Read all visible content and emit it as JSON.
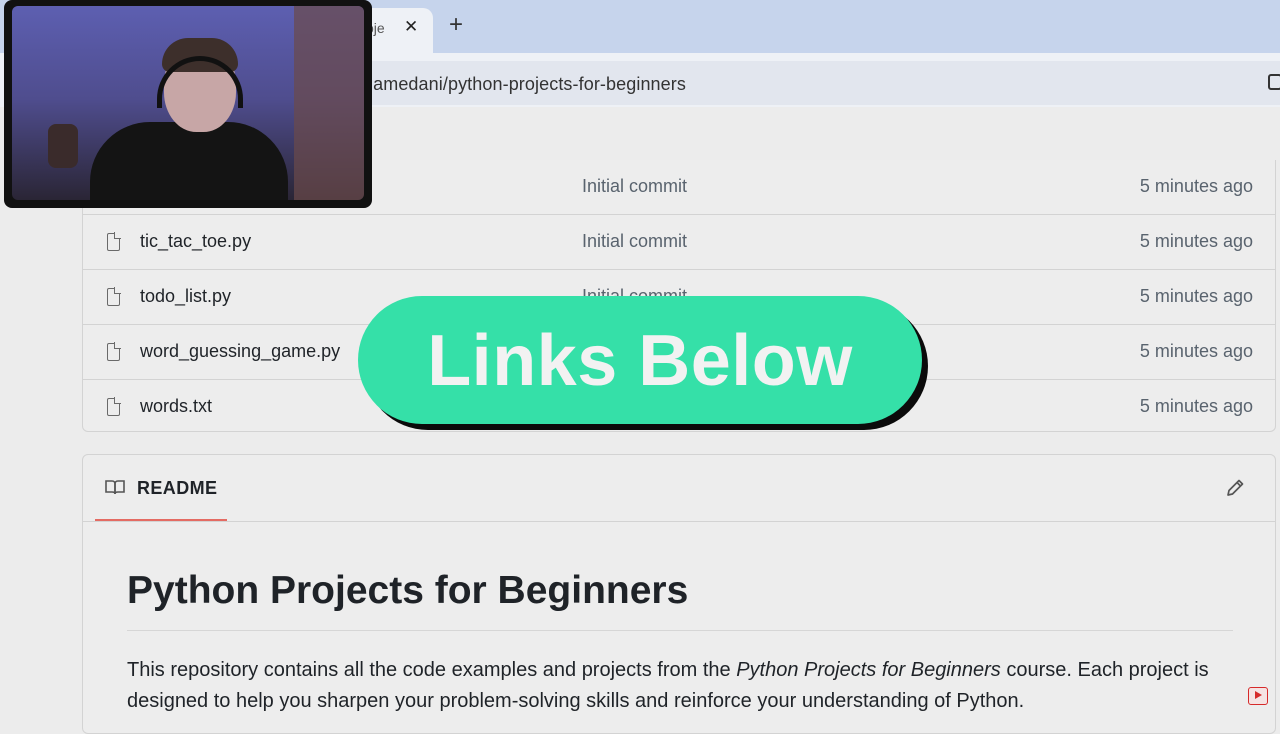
{
  "browser": {
    "tab_title_fragment": "oje",
    "tab_close": "✕",
    "new_tab": "+",
    "url": "hamedani/python-projects-for-beginners"
  },
  "file_list": {
    "rows": [
      {
        "name": "",
        "commit": "Initial commit",
        "time": "5 minutes ago"
      },
      {
        "name": "tic_tac_toe.py",
        "commit": "Initial commit",
        "time": "5 minutes ago"
      },
      {
        "name": "todo_list.py",
        "commit": "Initial commit",
        "time": "5 minutes ago"
      },
      {
        "name": "word_guessing_game.py",
        "commit": "",
        "time": "5 minutes ago"
      },
      {
        "name": "words.txt",
        "commit": "",
        "time": "5 minutes ago"
      }
    ]
  },
  "readme": {
    "tab_label": "README",
    "title": "Python Projects for Beginners",
    "para_part1": "This repository contains all the code examples and projects from the ",
    "para_italic": "Python Projects for Beginners",
    "para_part2": " course. Each project is designed to help you sharpen your problem-solving skills and reinforce your understanding of Python."
  },
  "overlay": {
    "banner_text": "Links Below"
  },
  "colors": {
    "banner": "#35e0a8",
    "readme_tab_underline": "#e46b63",
    "tabstrip": "#c6d4ec"
  }
}
